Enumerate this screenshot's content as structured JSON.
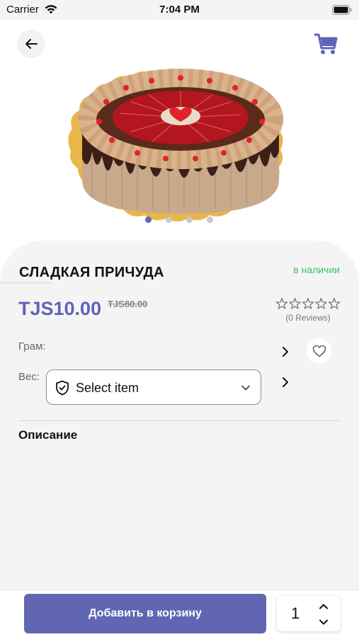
{
  "status": {
    "carrier": "Carrier",
    "time": "7:04 PM"
  },
  "product": {
    "title": "СЛАДКАЯ ПРИЧУДА",
    "stock": "в наличии",
    "price": "TJS10.00",
    "old_price": "TJS80.00",
    "rating": 0,
    "reviews": "(0 Reviews)"
  },
  "options": {
    "gram_label": "Грам:",
    "weight_label": "Вес:",
    "select_placeholder": "Select item"
  },
  "description": {
    "title": "Описание"
  },
  "cart": {
    "add_label": "Добавить в корзину",
    "quantity": "1"
  },
  "gallery": {
    "current_index": 0,
    "count": 4
  },
  "colors": {
    "accent": "#6166b3",
    "price": "#5f63b8",
    "in_stock": "#3ec26b",
    "sheet_background": "#f4f4f4"
  },
  "icons": {
    "back": "arrow-left-icon",
    "cart": "shopping-cart-icon",
    "favorite": "heart-outline-icon",
    "select": "shield-check-icon",
    "rating": "star-outline-icon"
  }
}
